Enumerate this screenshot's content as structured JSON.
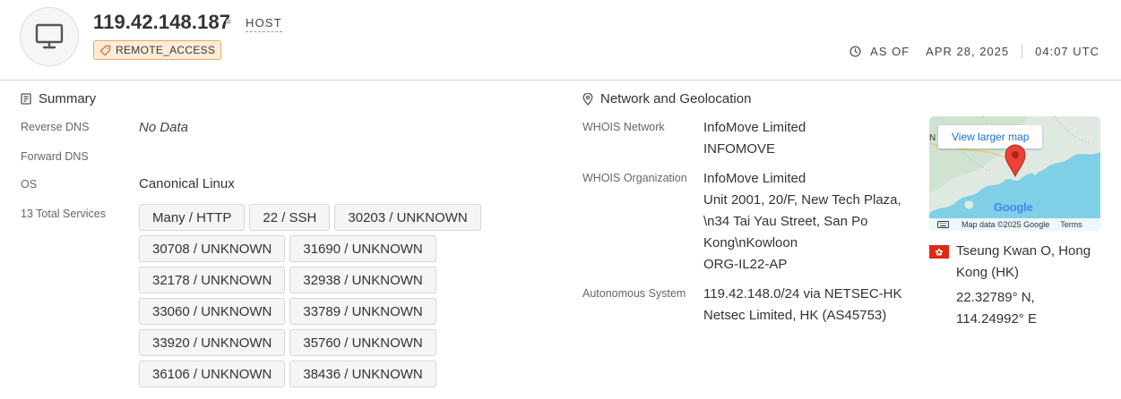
{
  "header": {
    "ip": "119.42.148.187",
    "type": "HOST",
    "tag": "REMOTE_ACCESS",
    "as_of_label": "AS OF",
    "as_of_date": "APR 28, 2025",
    "as_of_time": "04:07 UTC"
  },
  "summary": {
    "title": "Summary",
    "reverse_dns_label": "Reverse DNS",
    "reverse_dns_value": "No Data",
    "forward_dns_label": "Forward DNS",
    "os_label": "OS",
    "os_value": "Canonical Linux",
    "services_label": "13 Total Services",
    "services": [
      "Many / HTTP",
      "22 / SSH",
      "30203 / UNKNOWN",
      "30708 / UNKNOWN",
      "31690 / UNKNOWN",
      "32178 / UNKNOWN",
      "32938 / UNKNOWN",
      "33060 / UNKNOWN",
      "33789 / UNKNOWN",
      "33920 / UNKNOWN",
      "35760 / UNKNOWN",
      "36106 / UNKNOWN",
      "38436 / UNKNOWN"
    ]
  },
  "network": {
    "title": "Network and Geolocation",
    "whois_network_label": "WHOIS Network",
    "whois_network_lines": [
      "InfoMove Limited",
      "INFOMOVE"
    ],
    "whois_org_label": "WHOIS Organization",
    "whois_org_lines": [
      "InfoMove Limited",
      "Unit 2001, 20/F, New Tech Plaza,",
      "\\n34 Tai Yau Street, San Po",
      "Kong\\nKowloon",
      "ORG-IL22-AP"
    ],
    "asn_label": "Autonomous System",
    "asn_lines": [
      "119.42.148.0/24 via NETSEC-HK",
      "Netsec Limited, HK (AS45753)"
    ]
  },
  "map": {
    "button": "View larger map",
    "logo": "Google",
    "attribution": "Map data ©2025 Google",
    "terms": "Terms",
    "edge_label": "N"
  },
  "geo": {
    "location_lines": [
      "Tseung Kwan O, Hong",
      "Kong (HK)"
    ],
    "lat": "22.32789° N,",
    "lon": "114.24992° E"
  },
  "colors": {
    "tag_bg": "#fdebd6",
    "tag_border": "#e9a869",
    "link": "#1a6fd8",
    "pin": "#ea4335",
    "flag": "#de2910"
  }
}
